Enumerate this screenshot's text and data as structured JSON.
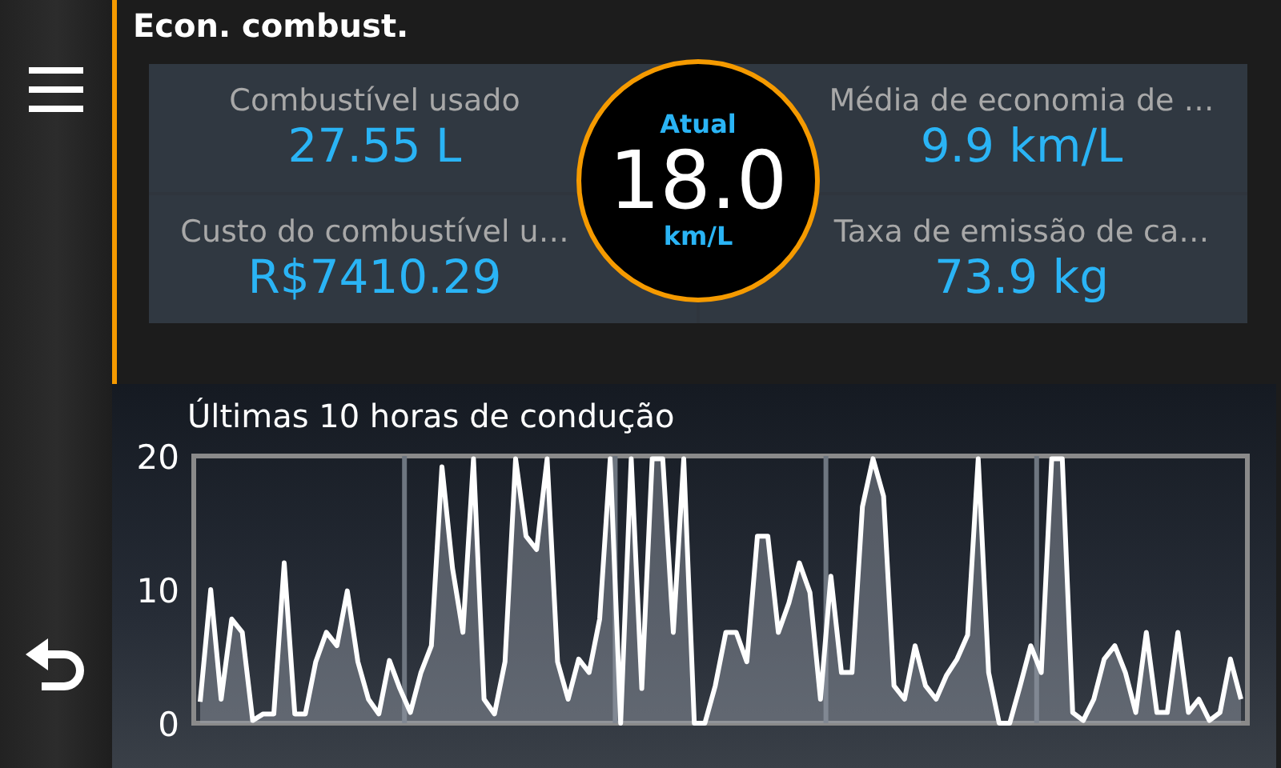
{
  "title": "Econ. combust.",
  "stats": [
    {
      "label": "Combustível usado",
      "value": "27.55 L"
    },
    {
      "label": "Média de economia de …",
      "value": "9.9 km/L"
    },
    {
      "label": "Custo do combustível u…",
      "value": "R$7410.29"
    },
    {
      "label": "Taxa de emissão de ca…",
      "value": "73.9 kg"
    }
  ],
  "gauge": {
    "label": "Atual",
    "value": "18.0",
    "unit": "km/L"
  },
  "chart": {
    "title": "Últimas 10 horas de condução",
    "chart_data": {
      "type": "area",
      "ylim": [
        0,
        20
      ],
      "yticks": [
        0,
        10,
        20
      ],
      "series": [
        {
          "color": "#ffffff",
          "values": [
            1.6,
            10,
            1.8,
            7.8,
            6.8,
            0.2,
            0.7,
            0.7,
            12,
            0.7,
            0.7,
            4.6,
            6.8,
            5.8,
            9.9,
            4.6,
            1.8,
            0.7,
            4.7,
            2.6,
            0.8,
            3.8,
            5.8,
            19.2,
            11.6,
            6.8,
            19.8,
            1.8,
            0.7,
            4.6,
            19.8,
            14,
            13,
            19.8,
            4.6,
            1.8,
            4.8,
            3.8,
            7.8,
            19.8,
            0,
            19.8,
            2.6,
            19.8,
            19.8,
            6.8,
            19.8,
            0,
            0,
            2.8,
            6.8,
            6.8,
            4.6,
            14,
            14,
            6.8,
            9,
            12,
            9.8,
            1.8,
            11,
            3.8,
            3.8,
            16.2,
            19.8,
            17,
            2.8,
            1.8,
            5.8,
            2.8,
            1.8,
            3.6,
            4.8,
            6.6,
            19.8,
            3.8,
            0,
            0,
            2.8,
            5.8,
            3.8,
            19.8,
            19.8,
            0.8,
            0.2,
            1.8,
            4.8,
            5.8,
            3.8,
            0.8,
            6.8,
            0.8,
            0.8,
            6.8,
            0.8,
            1.8,
            0.2,
            0.8,
            4.8,
            1.8
          ]
        }
      ]
    }
  }
}
